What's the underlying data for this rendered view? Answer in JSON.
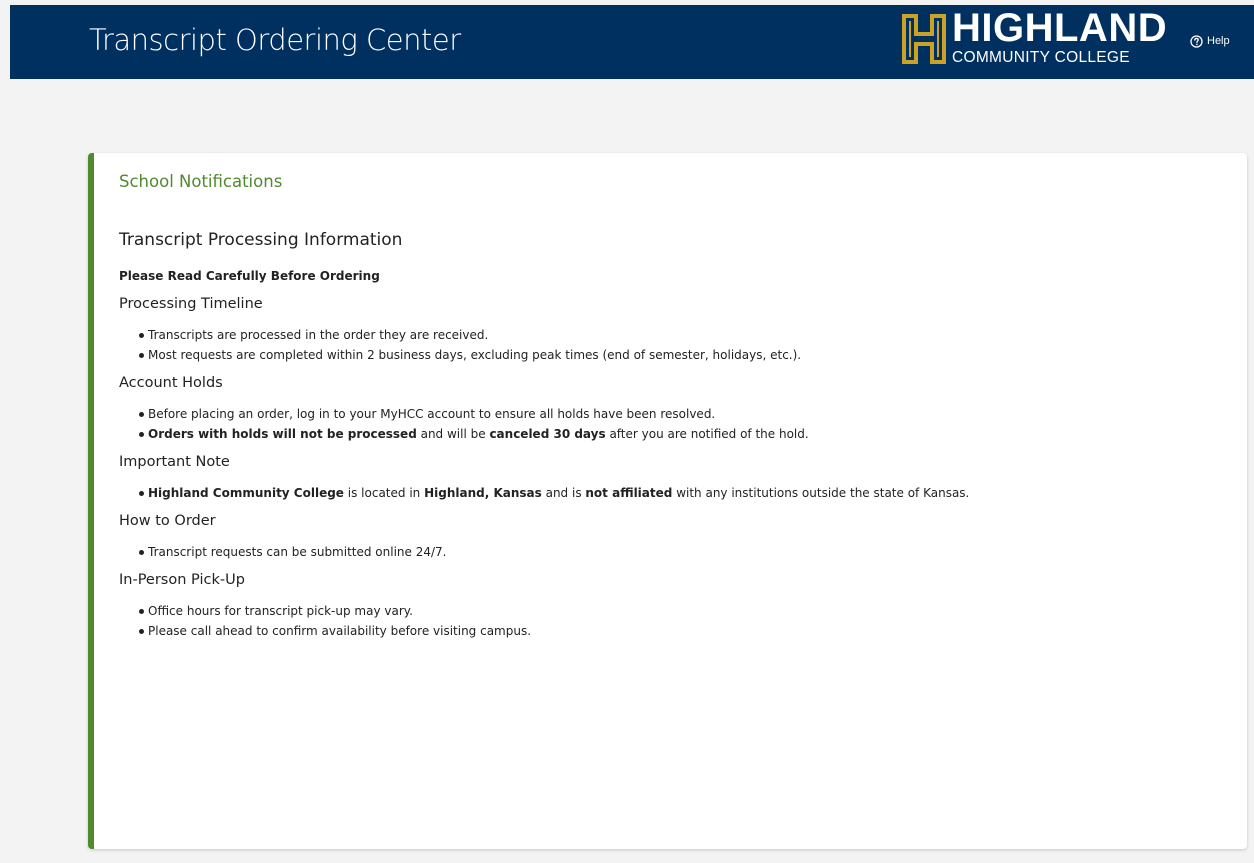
{
  "header": {
    "title": "Transcript Ordering Center",
    "logo_line1": "HIGHLAND",
    "logo_line2": "COMMUNITY COLLEGE",
    "help_label": "Help",
    "background": "#00305f",
    "help_icon": "question-circle-icon"
  },
  "card": {
    "title": "School Notifications",
    "accent_color": "#4f8a2f",
    "heading": "Transcript Processing Information",
    "intro": "Please Read Carefully Before Ordering",
    "sections": [
      {
        "title": "Processing Timeline",
        "items": [
          {
            "parts": [
              {
                "text": "Transcripts are processed in the order they are received.",
                "bold": false
              }
            ]
          },
          {
            "parts": [
              {
                "text": "Most requests are completed within 2 business days, excluding peak times (end of semester, holidays, etc.).",
                "bold": false
              }
            ]
          }
        ]
      },
      {
        "title": "Account Holds",
        "items": [
          {
            "parts": [
              {
                "text": "Before placing an order, log in to your MyHCC account to ensure all holds have been resolved.",
                "bold": false
              }
            ]
          },
          {
            "parts": [
              {
                "text": "Orders with holds will not be processed",
                "bold": true
              },
              {
                "text": " and will be ",
                "bold": false
              },
              {
                "text": "canceled 30 days",
                "bold": true
              },
              {
                "text": " after you are notified of the hold.",
                "bold": false
              }
            ]
          }
        ]
      },
      {
        "title": "Important Note",
        "items": [
          {
            "parts": [
              {
                "text": "Highland Community College",
                "bold": true
              },
              {
                "text": " is located in ",
                "bold": false
              },
              {
                "text": "Highland, Kansas",
                "bold": true
              },
              {
                "text": " and is ",
                "bold": false
              },
              {
                "text": "not affiliated",
                "bold": true
              },
              {
                "text": " with any institutions outside the state of Kansas.",
                "bold": false
              }
            ]
          }
        ]
      },
      {
        "title": "How to Order",
        "items": [
          {
            "parts": [
              {
                "text": "Transcript requests can be submitted online 24/7.",
                "bold": false
              }
            ]
          }
        ]
      },
      {
        "title": "In-Person Pick-Up",
        "items": [
          {
            "parts": [
              {
                "text": "Office hours for transcript pick-up may vary.",
                "bold": false
              }
            ]
          },
          {
            "parts": [
              {
                "text": "Please call ahead to confirm availability before visiting campus.",
                "bold": false
              }
            ]
          }
        ]
      }
    ]
  }
}
